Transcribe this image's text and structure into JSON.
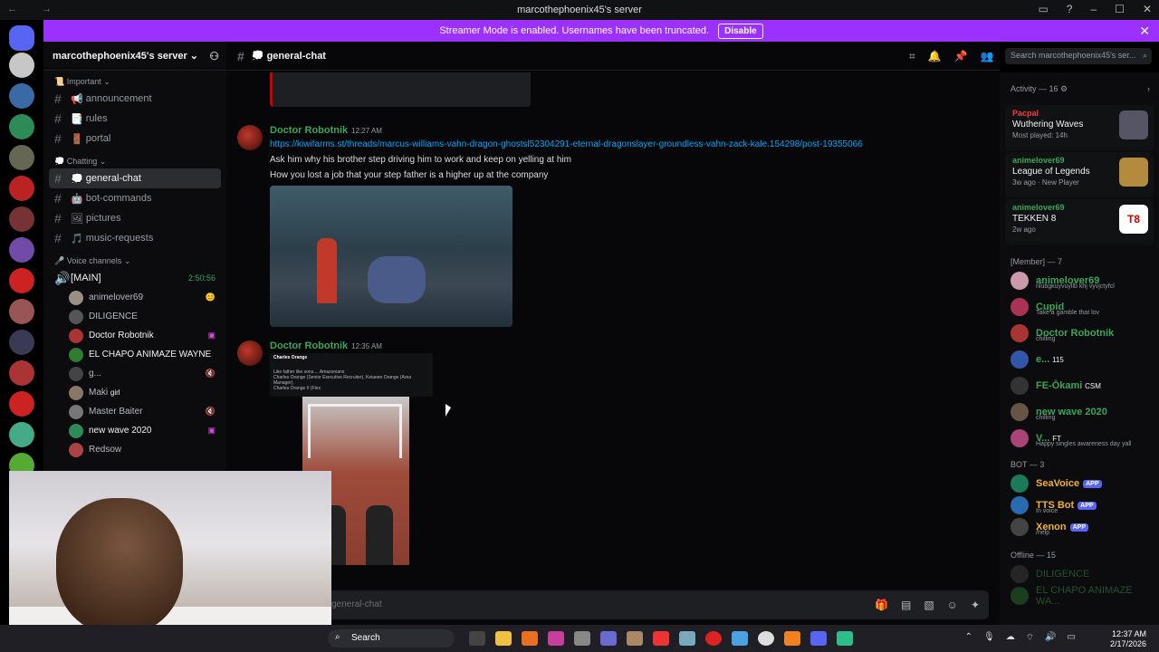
{
  "window": {
    "title": "marcothephoenix45's server"
  },
  "banner": {
    "text": "Streamer Mode is enabled. Usernames have been truncated.",
    "button": "Disable"
  },
  "server": {
    "name": "marcothephoenix45's server"
  },
  "categories": {
    "important": "Important",
    "chatting": "Chatting",
    "voice": "Voice channels"
  },
  "channels": {
    "announcement": "announcement",
    "rules": "rules",
    "portal": "portal",
    "general": "general-chat",
    "bot": "bot-commands",
    "pictures": "pictures",
    "music": "music-requests",
    "main_voice": "[MAIN]"
  },
  "voice": {
    "timer": "2:50:56",
    "users": [
      "animelover69",
      "DILIGENCE",
      "Doctor Robotnik",
      "EL CHAPO ANIMAZE WAYNE",
      "g...",
      "Maki",
      "Master Baiter",
      "new wave 2020",
      "Redsow"
    ],
    "maki_tag": "girl"
  },
  "header": {
    "channel": "general-chat",
    "search_placeholder": "Search marcothephoenix45's ser..."
  },
  "messages": [
    {
      "author": "Doctor Robotnik",
      "time": "12:27 AM",
      "link": "https://kiwifarms.st/threads/marcus-williams-vahn-dragon-ghostsl52304291-eternal-dragonslayer-groundless-vahn-zack-kale.154298/post-19355066",
      "lines": [
        "Ask him why his brother step driving him to work and keep on yelling at him",
        "How you lost a job that your step father is a higher up at the company"
      ]
    },
    {
      "author": "Doctor Robotnik",
      "time": "12:35 AM",
      "card_name": "Charles Orange",
      "card_text": "Like father like sons.... Amazonians",
      "card_text2": "Charles Orange (Senior Executive Recruiter), Keiaeen Orange (Area Manager),",
      "card_text3": "Charles Orange II (Flex"
    }
  ],
  "composer": {
    "placeholder": "general-chat"
  },
  "activity": {
    "header": "Activity — 16",
    "items": [
      {
        "user": "Pacpal",
        "game": "Wuthering Waves",
        "sub": "Most played: 14h"
      },
      {
        "user": "animelover69",
        "game": "League of Legends",
        "sub": "3w ago · New Player"
      },
      {
        "user": "animelover69",
        "game": "TEKKEN 8",
        "sub": "2w ago"
      }
    ]
  },
  "members": {
    "header": "[Member] — 7",
    "list": [
      {
        "name": "animelover69",
        "status": "nlubgkuyvuyllb khj vyvjctyfcl",
        "color": "#3ba55c"
      },
      {
        "name": "Cupid",
        "status": "Take a gamble that lov",
        "color": "#3ba55c"
      },
      {
        "name": "Doctor Robotnik",
        "status": "chilling",
        "color": "#3ba55c"
      },
      {
        "name": "e...",
        "status": "",
        "color": "#3ba55c"
      },
      {
        "name": "FE-Ōkami",
        "status": "",
        "color": "#3ba55c"
      },
      {
        "name": "new wave 2020",
        "status": "chilling",
        "color": "#3ba55c"
      },
      {
        "name": "V...",
        "status": "Happy singles awareness day yall",
        "color": "#3ba55c"
      }
    ],
    "e_badge": "115",
    "fe_badge": "CSM",
    "v_badge": "FT"
  },
  "bots": {
    "header": "BOT — 3",
    "list": [
      {
        "name": "SeaVoice",
        "status": ""
      },
      {
        "name": "TTS Bot",
        "status": "In voice"
      },
      {
        "name": "Xenon",
        "status": "/help"
      }
    ],
    "app_label": "APP"
  },
  "offline": {
    "header": "Offline — 15",
    "list": [
      "DILIGENCE",
      "EL CHAPO ANIMAZE WA..."
    ]
  },
  "taskbar": {
    "search": "Search",
    "time": "12:37 AM",
    "date": "2/17/2026"
  }
}
